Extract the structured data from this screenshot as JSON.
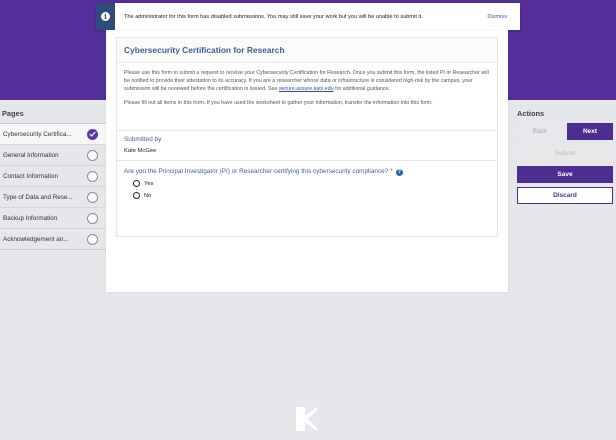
{
  "banner": {
    "icon": "info-icon",
    "message": "The administrator for this form has disabled submissions. You may still save your work but you will be unable to submit it.",
    "dismiss_label": "Dismiss"
  },
  "pages": {
    "title": "Pages",
    "items": [
      {
        "label": "Cybersecurity Certifica...",
        "status": "complete"
      },
      {
        "label": "General Information",
        "status": "incomplete"
      },
      {
        "label": "Contact Information",
        "status": "incomplete"
      },
      {
        "label": "Type of Data and Rese...",
        "status": "incomplete"
      },
      {
        "label": "Backup Information",
        "status": "incomplete"
      },
      {
        "label": "Acknowledgement an...",
        "status": "incomplete"
      }
    ]
  },
  "form": {
    "title": "Cybersecurity Certification for Research",
    "intro_text": "Please use this form to submit a request to receive your Cybersecurity Certification for Research. Once you submit this form, the listed PI or Researcher will be notified to provide their attestation to its accuracy. If you are a researcher whose data or infrastructure is considered high-risk by the campus, your submission will be reviewed before the certification is issued. See",
    "intro_link": "secure.assure.kats.edu",
    "intro_suffix": "for additional guidance.",
    "instruction": "Please fill out all items in this form. If you have used the worksheet to gather your information, transfer the information into this form.",
    "submitted_by_label": "Submitted by",
    "submitted_by_value": "Kate McGee",
    "question_label": "Are you the Principal Investigator (PI) or Researcher certifying this cybersecurity compliance?",
    "required_mark": "*",
    "help_icon": "?",
    "options": [
      "Yes",
      "No"
    ]
  },
  "actions": {
    "title": "Actions",
    "back_label": "Back",
    "next_label": "Next",
    "submit_label": "Submit",
    "save_label": "Save",
    "discard_label": "Discard"
  },
  "colors": {
    "brand_purple": "#552f99",
    "button_purple": "#4e2d90",
    "title_blue": "#3b5f95",
    "banner_icon_bg": "#2e4d7b"
  }
}
